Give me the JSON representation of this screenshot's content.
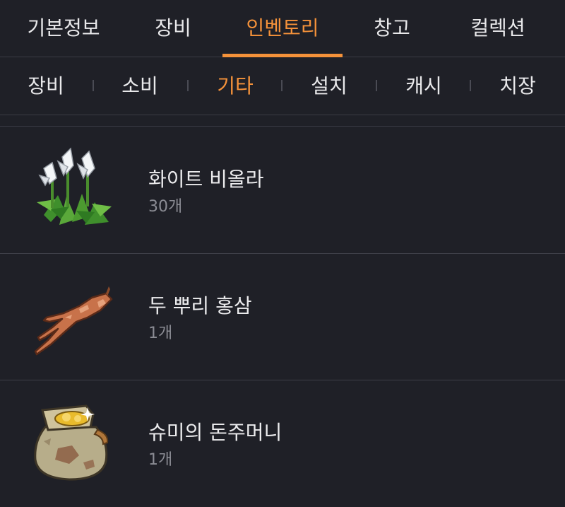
{
  "tabs": [
    {
      "label": "기본정보"
    },
    {
      "label": "장비"
    },
    {
      "label": "인벤토리"
    },
    {
      "label": "창고"
    },
    {
      "label": "컬렉션"
    }
  ],
  "active_tab": "인벤토리",
  "subtabs": [
    {
      "label": "장비"
    },
    {
      "label": "소비"
    },
    {
      "label": "기타"
    },
    {
      "label": "설치"
    },
    {
      "label": "캐시"
    },
    {
      "label": "치장"
    }
  ],
  "active_subtab": "기타",
  "items": [
    {
      "name": "화이트 비올라",
      "qty": "30개",
      "icon": "white-viola-flower-icon"
    },
    {
      "name": "두 뿌리 홍삼",
      "qty": "1개",
      "icon": "red-ginseng-root-icon"
    },
    {
      "name": "슈미의 돈주머니",
      "qty": "1개",
      "icon": "money-pouch-icon"
    }
  ],
  "colors": {
    "background": "#1f2027",
    "accent": "#f5923a",
    "text": "#e9e9eb",
    "subtext": "#8b8c94",
    "divider": "#3a3b44"
  }
}
